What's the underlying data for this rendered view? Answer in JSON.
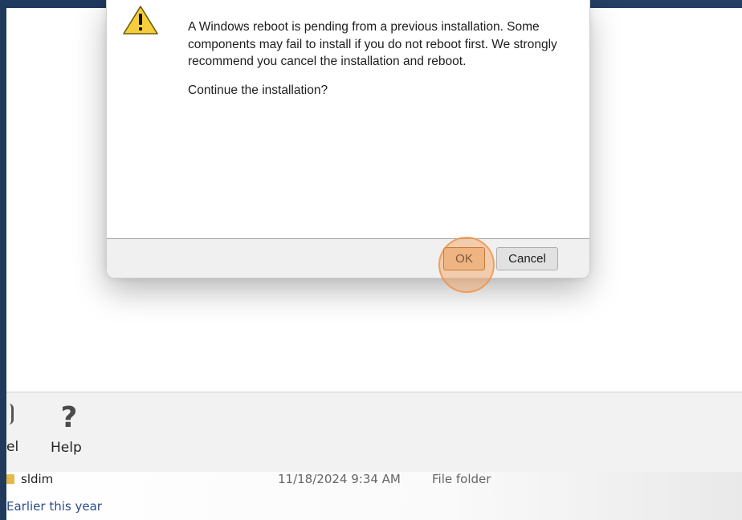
{
  "dialog": {
    "message": "A Windows reboot is pending from a previous installation. Some components may fail to install if you do not reboot first. We strongly recommend you cancel the installation and reboot.",
    "question": "Continue the installation?",
    "ok_label": "OK",
    "cancel_label": "Cancel",
    "icon": "warning-icon"
  },
  "toolbar": {
    "partial_label": "el",
    "help_label": "Help",
    "help_icon": "?"
  },
  "filelist": {
    "rows": [
      {
        "name": "sldim",
        "date": "11/18/2024 9:34 AM",
        "type": "File folder"
      }
    ],
    "group_header": "Earlier this year"
  },
  "colors": {
    "desktop": "#243f63",
    "highlight": "#f79e5a",
    "group_header": "#2d4c8a"
  }
}
